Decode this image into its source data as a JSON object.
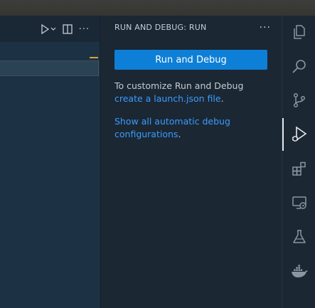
{
  "sidebar": {
    "title": "RUN AND DEBUG: RUN",
    "more_label": "···",
    "run_button_label": "Run and Debug",
    "customize_prefix": "To customize Run and Debug ",
    "customize_link": "create a launch.json file",
    "customize_suffix": ".",
    "show_link": "Show all automatic debug configurations",
    "show_suffix": "."
  },
  "editor": {
    "more_label": "···"
  },
  "activity_bar": {
    "items": [
      "explorer-icon",
      "search-icon",
      "source-control-icon",
      "run-debug-icon",
      "extensions-icon",
      "remote-explorer-icon",
      "testing-icon",
      "docker-icon"
    ],
    "active": "run-debug-icon"
  },
  "colors": {
    "accent": "#0e7fd6",
    "link": "#3b9cff",
    "background": "#1b2733",
    "editor_background": "#1d3145"
  }
}
